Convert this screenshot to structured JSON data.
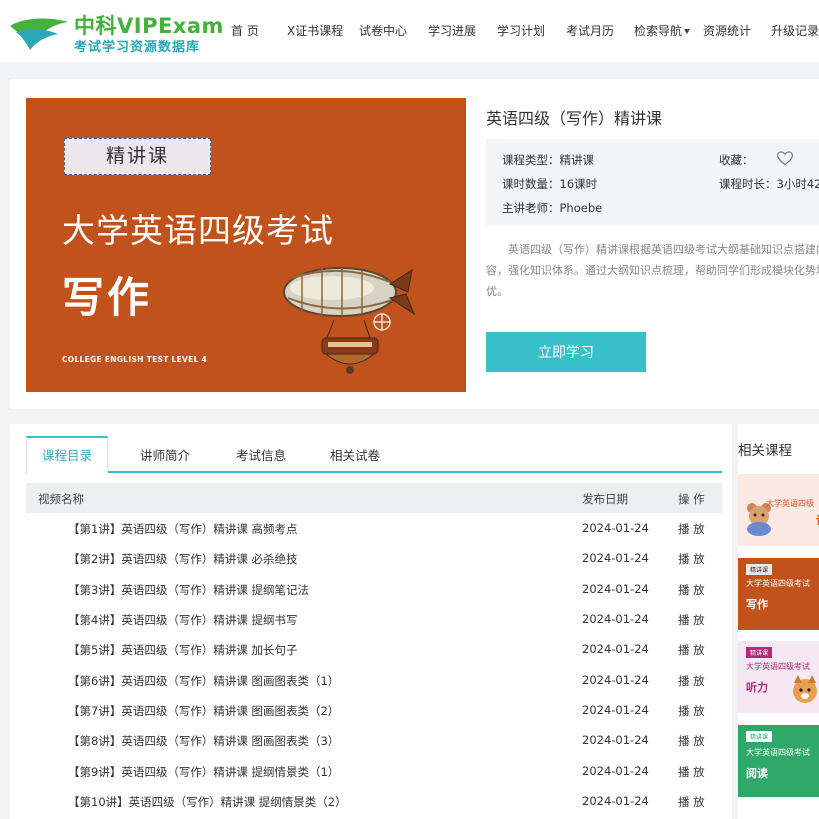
{
  "brand": {
    "name": "中科VIPExam",
    "slogan": "考试学习资源数据库"
  },
  "nav": [
    {
      "label": "首 页",
      "dropdown": false
    },
    {
      "label": "X证书课程",
      "dropdown": false
    },
    {
      "label": "试卷中心",
      "dropdown": false
    },
    {
      "label": "学习进展",
      "dropdown": false
    },
    {
      "label": "学习计划",
      "dropdown": false
    },
    {
      "label": "考试月历",
      "dropdown": false
    },
    {
      "label": "检索导航",
      "dropdown": true
    },
    {
      "label": "资源统计",
      "dropdown": false
    },
    {
      "label": "升级记录",
      "dropdown": false
    }
  ],
  "cover": {
    "tag": "精讲课",
    "title": "大学英语四级考试",
    "subject": "写作",
    "english": "COLLEGE ENGLISH TEST LEVEL 4",
    "bg_color": "#c1521c"
  },
  "course": {
    "title": "英语四级（写作）精讲课",
    "type_label": "课程类型：",
    "type_value": "精讲课",
    "count_label": "课时数量：",
    "count_value": "16课时",
    "teacher_label": "主讲老师：",
    "teacher_value": "Phoebe",
    "favorite_label": "收藏：",
    "duration_label": "课程时长：",
    "duration_value": "3小时42",
    "description": "英语四级（写作）精讲课根据英语四级考试大纲基础知识点搭建内容，强化知识体系。通过大纲知识点梳理，帮助同学们形成模块化势培优。",
    "study_button": "立即学习",
    "accent_color": "#37c0c8"
  },
  "tabs": [
    {
      "label": "课程目录",
      "active": true
    },
    {
      "label": "讲师简介",
      "active": false
    },
    {
      "label": "考试信息",
      "active": false
    },
    {
      "label": "相关试卷",
      "active": false
    }
  ],
  "table": {
    "headers": {
      "name": "视频名称",
      "date": "发布日期",
      "action": "操 作"
    },
    "rows": [
      {
        "name": "【第1讲】英语四级（写作）精讲课 高频考点",
        "date": "2024-01-24",
        "action": "播 放"
      },
      {
        "name": "【第2讲】英语四级（写作）精讲课 必杀绝技",
        "date": "2024-01-24",
        "action": "播 放"
      },
      {
        "name": "【第3讲】英语四级（写作）精讲课 提纲笔记法",
        "date": "2024-01-24",
        "action": "播 放"
      },
      {
        "name": "【第4讲】英语四级（写作）精讲课 提纲书写",
        "date": "2024-01-24",
        "action": "播 放"
      },
      {
        "name": "【第5讲】英语四级（写作）精讲课 加长句子",
        "date": "2024-01-24",
        "action": "播 放"
      },
      {
        "name": "【第6讲】英语四级（写作）精讲课 图画图表类（1）",
        "date": "2024-01-24",
        "action": "播 放"
      },
      {
        "name": "【第7讲】英语四级（写作）精讲课 图画图表类（2）",
        "date": "2024-01-24",
        "action": "播 放"
      },
      {
        "name": "【第8讲】英语四级（写作）精讲课 图画图表类（3）",
        "date": "2024-01-24",
        "action": "播 放"
      },
      {
        "name": "【第9讲】英语四级（写作）精讲课 提纲情景类（1）",
        "date": "2024-01-24",
        "action": "播 放"
      },
      {
        "name": "【第10讲】英语四级（写作）精讲课 提纲情景类（2）",
        "date": "2024-01-24",
        "action": "播 放"
      }
    ]
  },
  "related": {
    "title": "相关课程",
    "items": [
      {
        "line1": "大学英语四级",
        "line2": "读",
        "bg": "#fbe9e4",
        "fg": "#d9532b"
      },
      {
        "tag": "精讲课",
        "line1": "大学英语四级考试",
        "line2": "写作",
        "bg": "#c1521c",
        "fg": "#ffffff"
      },
      {
        "tag": "精讲课",
        "line1": "大学英语四级考试",
        "line2": "听力",
        "bg": "#f6e8f3",
        "fg": "#b2287a"
      },
      {
        "tag": "精讲课",
        "line1": "大学英语四级考试",
        "line2": "阅读",
        "bg": "#2fa86a",
        "fg": "#ffffff"
      }
    ]
  }
}
